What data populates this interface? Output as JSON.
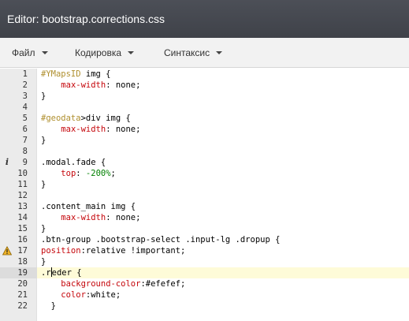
{
  "window": {
    "title": "Editor: bootstrap.corrections.css"
  },
  "menu": {
    "items": [
      {
        "label": "Файл"
      },
      {
        "label": "Кодировка"
      },
      {
        "label": "Синтаксис"
      }
    ]
  },
  "editor": {
    "active_line": 19,
    "markers": {
      "9": "info",
      "17": "warning"
    },
    "lines": [
      {
        "num": "1",
        "segs": [
          [
            "id",
            "#YMapsID"
          ],
          [
            "plain",
            " img {"
          ]
        ]
      },
      {
        "num": "2",
        "segs": [
          [
            "plain",
            "    "
          ],
          [
            "prop",
            "max-width"
          ],
          [
            "plain",
            ": none;"
          ]
        ]
      },
      {
        "num": "3",
        "segs": [
          [
            "plain",
            "}"
          ]
        ]
      },
      {
        "num": "4",
        "segs": []
      },
      {
        "num": "5",
        "segs": [
          [
            "id",
            "#geodata"
          ],
          [
            "plain",
            ">div img {"
          ]
        ]
      },
      {
        "num": "6",
        "segs": [
          [
            "plain",
            "    "
          ],
          [
            "prop",
            "max-width"
          ],
          [
            "plain",
            ": none;"
          ]
        ]
      },
      {
        "num": "7",
        "segs": [
          [
            "plain",
            "}"
          ]
        ]
      },
      {
        "num": "8",
        "segs": []
      },
      {
        "num": "9",
        "segs": [
          [
            "plain",
            ".modal.fade {"
          ]
        ]
      },
      {
        "num": "10",
        "segs": [
          [
            "plain",
            "    "
          ],
          [
            "prop",
            "top"
          ],
          [
            "plain",
            ": "
          ],
          [
            "num",
            "-200%"
          ],
          [
            "plain",
            ";"
          ]
        ]
      },
      {
        "num": "11",
        "segs": [
          [
            "plain",
            "}"
          ]
        ]
      },
      {
        "num": "12",
        "segs": []
      },
      {
        "num": "13",
        "segs": [
          [
            "plain",
            ".content_main img {"
          ]
        ]
      },
      {
        "num": "14",
        "segs": [
          [
            "plain",
            "    "
          ],
          [
            "prop",
            "max-width"
          ],
          [
            "plain",
            ": none;"
          ]
        ]
      },
      {
        "num": "15",
        "segs": [
          [
            "plain",
            "}"
          ]
        ]
      },
      {
        "num": "16",
        "segs": [
          [
            "plain",
            ".btn-group .bootstrap-select .input-lg .dropup {"
          ]
        ]
      },
      {
        "num": "17",
        "segs": [
          [
            "prop",
            "position"
          ],
          [
            "plain",
            ":relative !important;"
          ]
        ]
      },
      {
        "num": "18",
        "segs": [
          [
            "plain",
            "}"
          ]
        ]
      },
      {
        "num": "19",
        "segs": [
          [
            "plain",
            ".r"
          ],
          [
            "cursor",
            ""
          ],
          [
            "plain",
            "eder {"
          ]
        ]
      },
      {
        "num": "20",
        "segs": [
          [
            "plain",
            "    "
          ],
          [
            "prop",
            "background-color"
          ],
          [
            "plain",
            ":#efefef;"
          ]
        ]
      },
      {
        "num": "21",
        "segs": [
          [
            "plain",
            "    "
          ],
          [
            "prop",
            "color"
          ],
          [
            "plain",
            ":white;"
          ]
        ]
      },
      {
        "num": "22",
        "segs": [
          [
            "plain",
            "  }"
          ]
        ]
      }
    ]
  }
}
